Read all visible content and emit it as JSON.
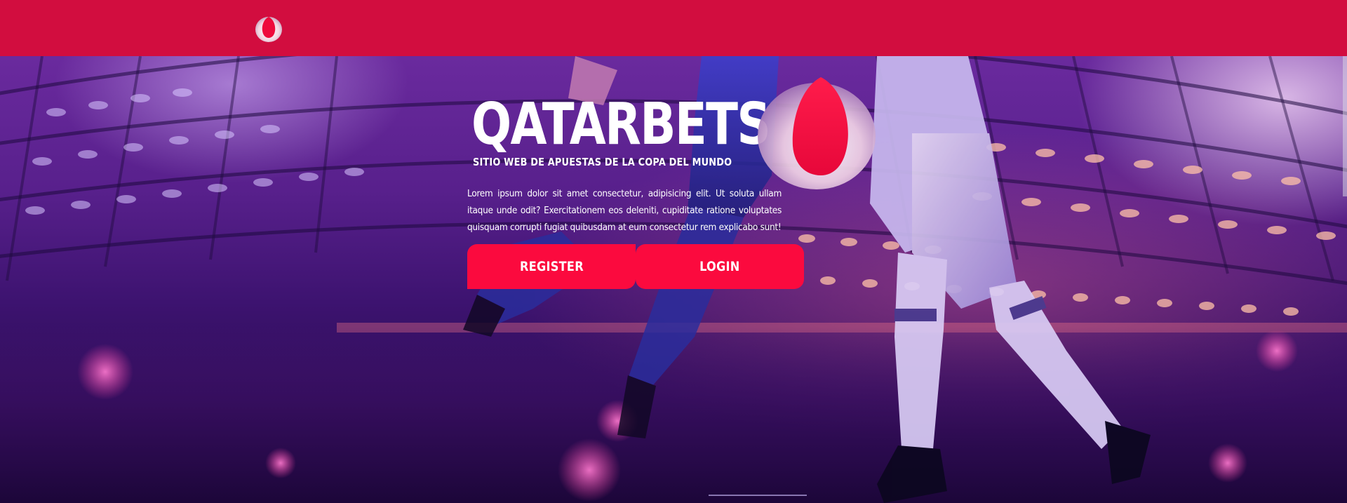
{
  "header": {
    "logo_icon": "qatarbets-drop-logo-icon",
    "background_color": "#d20d3f"
  },
  "hero": {
    "title": "QATARBETS",
    "tagline": "SITIO WEB DE APUESTAS DE LA COPA DEL MUNDO",
    "description": "Lorem ipsum dolor sit amet consectetur, adipisicing elit. Ut soluta ullam itaque unde odit? Exercitationem eos deleniti, cupiditate ratione voluptates quisquam corrupti fugiat quibusdam at eum consectetur rem explicabo sunt!",
    "logo_icon": "qatarbets-drop-logo-icon",
    "background_image": "stadium-football-players-photo"
  },
  "buttons": {
    "register_label": "REGISTER",
    "login_label": "LOGIN",
    "color": "#fb0a3e"
  },
  "colors": {
    "accent": "#fb0a3e",
    "overlay": "#5a1f8f"
  }
}
